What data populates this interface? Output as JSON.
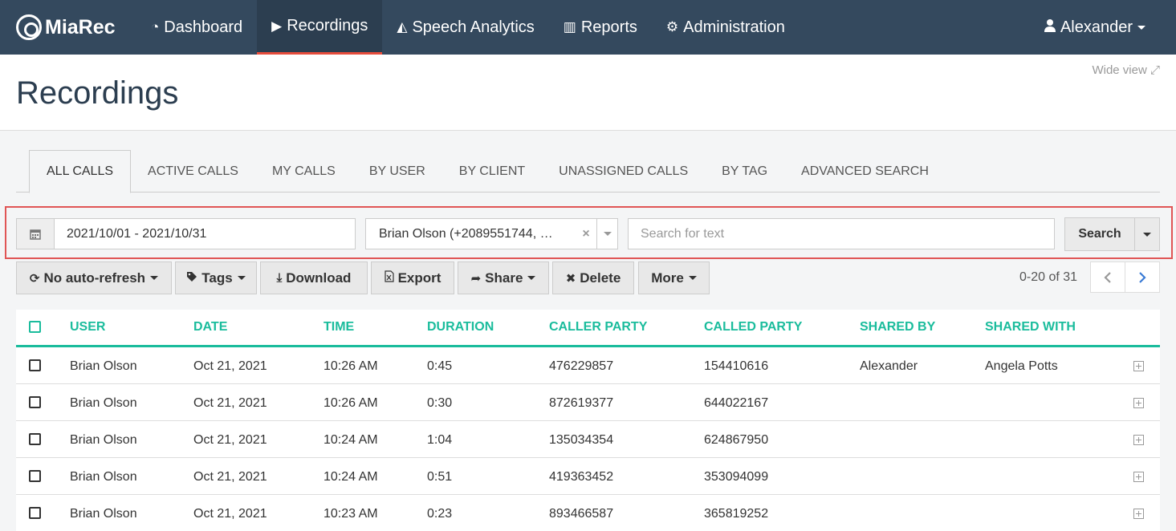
{
  "nav": {
    "brand": "MiaRec",
    "items": [
      {
        "label": "Dashboard",
        "icon": "dashboard-icon",
        "glyph": "◔"
      },
      {
        "label": "Recordings",
        "icon": "play-square-icon",
        "glyph": "▶"
      },
      {
        "label": "Speech Analytics",
        "icon": "area-chart-icon",
        "glyph": "◭"
      },
      {
        "label": "Reports",
        "icon": "bar-chart-icon",
        "glyph": "▥"
      },
      {
        "label": "Administration",
        "icon": "gear-icon",
        "glyph": "⚙"
      }
    ],
    "user": "Alexander"
  },
  "header": {
    "title": "Recordings",
    "wide_view": "Wide view ⤢"
  },
  "tabs": [
    "ALL CALLS",
    "ACTIVE CALLS",
    "MY CALLS",
    "BY USER",
    "BY CLIENT",
    "UNASSIGNED CALLS",
    "BY TAG",
    "ADVANCED SEARCH"
  ],
  "filter": {
    "date_range": "2021/10/01 - 2021/10/31",
    "user_value": "Brian Olson (+2089551744, …",
    "search_placeholder": "Search for text",
    "search_label": "Search"
  },
  "toolbar": {
    "auto_refresh": "No auto-refresh",
    "tags": "Tags",
    "download": "Download",
    "export": "Export",
    "share": "Share",
    "delete": "Delete",
    "more": "More"
  },
  "pager": {
    "text": "0-20 of 31"
  },
  "table": {
    "columns": [
      "USER",
      "DATE",
      "TIME",
      "DURATION",
      "CALLER PARTY",
      "CALLED PARTY",
      "SHARED BY",
      "SHARED WITH"
    ],
    "rows": [
      [
        "Brian Olson",
        "Oct 21, 2021",
        "10:26 AM",
        "0:45",
        "476229857",
        "154410616",
        "Alexander",
        "Angela Potts"
      ],
      [
        "Brian Olson",
        "Oct 21, 2021",
        "10:26 AM",
        "0:30",
        "872619377",
        "644022167",
        "",
        ""
      ],
      [
        "Brian Olson",
        "Oct 21, 2021",
        "10:24 AM",
        "1:04",
        "135034354",
        "624867950",
        "",
        ""
      ],
      [
        "Brian Olson",
        "Oct 21, 2021",
        "10:24 AM",
        "0:51",
        "419363452",
        "353094099",
        "",
        ""
      ],
      [
        "Brian Olson",
        "Oct 21, 2021",
        "10:23 AM",
        "0:23",
        "893466587",
        "365819252",
        "",
        ""
      ]
    ]
  }
}
